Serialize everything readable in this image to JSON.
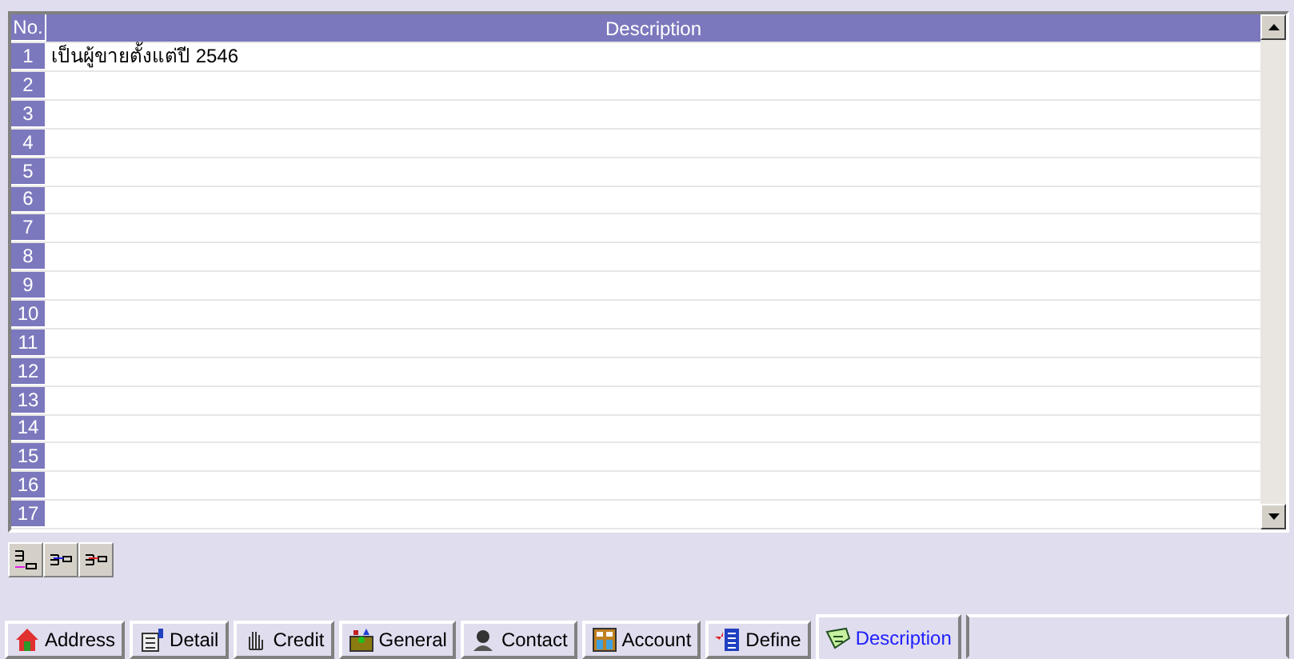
{
  "grid": {
    "columns": [
      "No.",
      "Description"
    ],
    "rows": [
      {
        "number": "1",
        "description": "เป็นผู้ขายตั้งแต่ปี 2546"
      },
      {
        "number": "2"
      },
      {
        "number": "3"
      },
      {
        "number": "4"
      },
      {
        "number": "5"
      },
      {
        "number": "6"
      },
      {
        "number": "7"
      },
      {
        "number": "8"
      },
      {
        "number": "9"
      },
      {
        "number": "10"
      },
      {
        "number": "11"
      },
      {
        "number": "12"
      },
      {
        "number": "13"
      },
      {
        "number": "14"
      },
      {
        "number": "15"
      },
      {
        "number": "16"
      },
      {
        "number": "17"
      }
    ]
  },
  "toolbar": [
    {
      "kind": "append"
    },
    {
      "kind": "insert"
    },
    {
      "kind": "delete"
    }
  ],
  "tabs": [
    {
      "label": "Address",
      "kind": "house",
      "selected": false
    },
    {
      "label": "Detail",
      "kind": "detail",
      "selected": false
    },
    {
      "label": "Credit",
      "kind": "hand",
      "selected": false
    },
    {
      "label": "General",
      "kind": "box",
      "selected": false
    },
    {
      "label": "Contact",
      "kind": "person",
      "selected": false
    },
    {
      "label": "Account",
      "kind": "ledger",
      "selected": false
    },
    {
      "label": "Define",
      "kind": "list",
      "selected": false
    },
    {
      "label": "Description",
      "kind": "note",
      "selected": true
    }
  ]
}
